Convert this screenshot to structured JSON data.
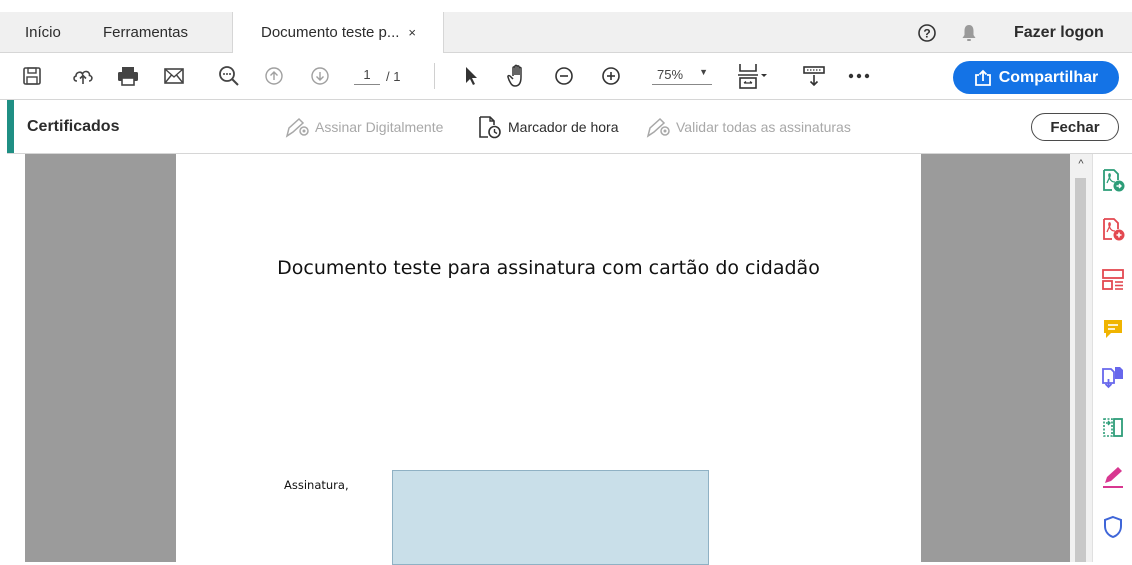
{
  "tabs": {
    "home": "Início",
    "tools": "Ferramentas",
    "document": "Documento teste p...",
    "close_symbol": "×"
  },
  "header": {
    "help_icon": "help-circle-icon",
    "notifications_icon": "bell-icon",
    "login": "Fazer logon"
  },
  "toolbar": {
    "icons": [
      "save-icon",
      "upload-cloud-icon",
      "print-icon",
      "email-icon",
      "search-icon",
      "prev-page-icon",
      "next-page-icon",
      "select-pointer-icon",
      "hand-icon",
      "zoom-out-icon",
      "zoom-in-icon",
      "fit-page-icon",
      "scroll-mode-icon",
      "more-icon"
    ],
    "page_current": "1",
    "page_total": "/ 1",
    "zoom": "75%",
    "share_label": "Compartilhar",
    "colors": {
      "accent": "#1473e6"
    }
  },
  "certificates": {
    "title": "Certificados",
    "sign_digitally": "Assinar Digitalmente",
    "timestamp": "Marcador de hora",
    "validate_all": "Validar todas as assinaturas",
    "close": "Fechar",
    "colors": {
      "accent": "#1f8f84"
    }
  },
  "document": {
    "title": "Documento teste para assinatura com cartão do cidadão",
    "signature_label": "Assinatura,"
  },
  "right_panel": {
    "icons": [
      "export-pdf-icon",
      "create-pdf-icon",
      "edit-pdf-icon",
      "comment-icon",
      "combine-files-icon",
      "organize-pages-icon",
      "fill-sign-icon",
      "protect-icon"
    ]
  }
}
